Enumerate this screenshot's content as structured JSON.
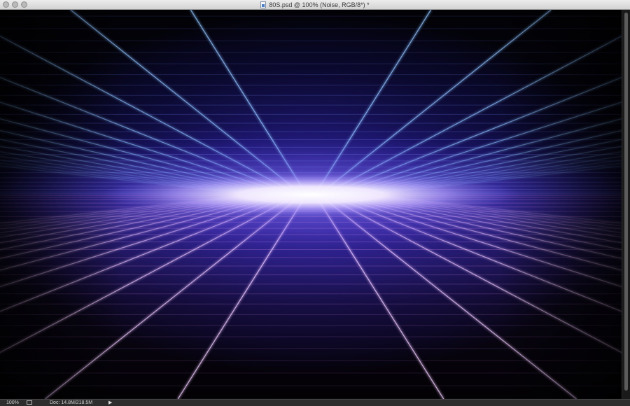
{
  "window": {
    "title": "80S.psd @ 100% (Noise, RGB/8*) *",
    "file_icon": "psd-file-icon"
  },
  "status": {
    "zoom": "100%",
    "doc_info": "Doc: 14.8M/218.5M",
    "menu_arrow": "▶"
  },
  "canvas": {
    "content": "synthwave-perspective-grid",
    "colors": {
      "sky_glow": "#3a2aa8",
      "floor_glow": "#5a3a9a",
      "horizon_core": "#ffffff",
      "ray_top": "#7fb8ff",
      "ray_bottom": "#e6b8ff"
    }
  }
}
